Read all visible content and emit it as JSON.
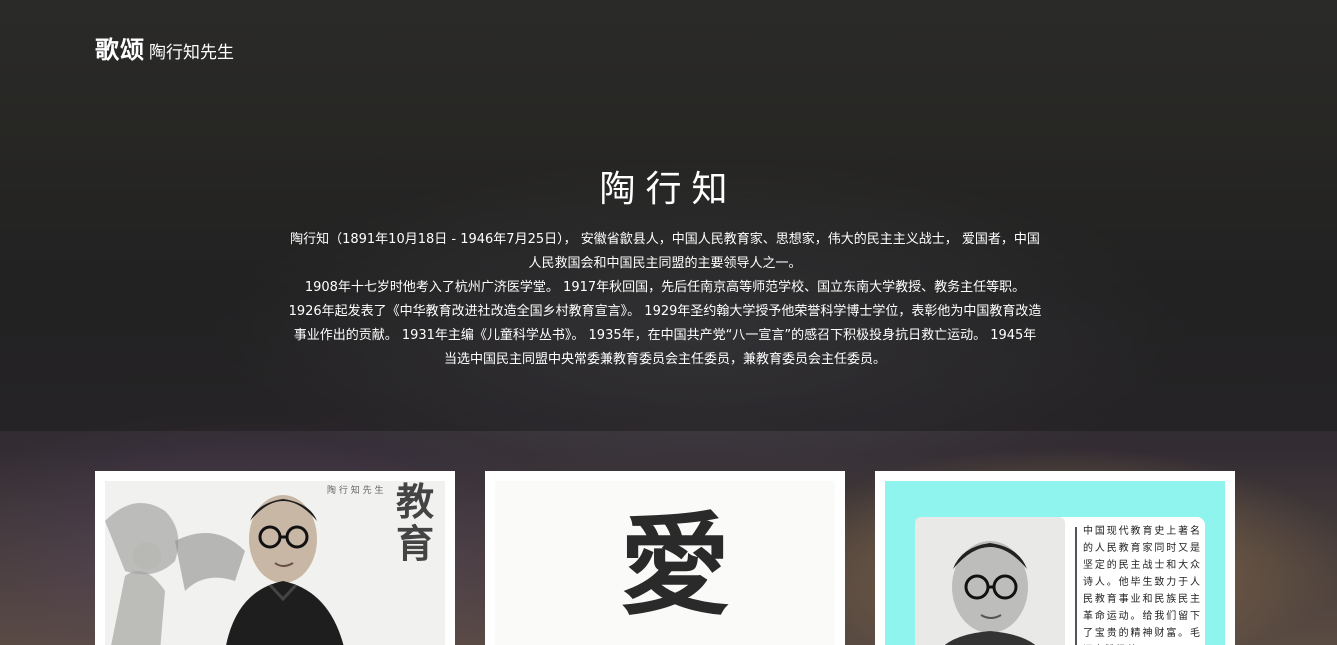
{
  "brand": {
    "main": "歌颂",
    "sub": "陶行知先生"
  },
  "hero": {
    "title": "陶行知",
    "paragraphs": [
      "陶行知（1891年10月18日 - 1946年7月25日）， 安徽省歙县人，中国人民教育家、思想家，伟大的民主主义战士， 爱国者，中国人民救国会和中国民主同盟的主要领导人之一。",
      "1908年十七岁时他考入了杭州广济医学堂。 1917年秋回国，先后任南京高等师范学校、国立东南大学教授、教务主任等职。 1926年起发表了《中华教育改进社改造全国乡村教育宣言》。 1929年圣约翰大学授予他荣誉科学博士学位，表彰他为中国教育改造事业作出的贡献。 1931年主编《儿童科学丛书》。 1935年，在中国共产党“八一宣言”的感召下积极投身抗日救亡运动。 1945年当选中国民主同盟中央常委兼教育委员会主任委员，兼教育委员会主任委员。"
    ]
  },
  "cards": [
    {
      "calligraphy": "教育"
    },
    {
      "calligraphy": "愛"
    },
    {
      "quote": "中国现代教育史上著名的人民教育家同时又是坚定的民主战士和大众诗人。他毕生致力于人民教育事业和民族民主革命运动。给我们留下了宝贵的精神财富。毛泽东赞扬他"
    }
  ]
}
